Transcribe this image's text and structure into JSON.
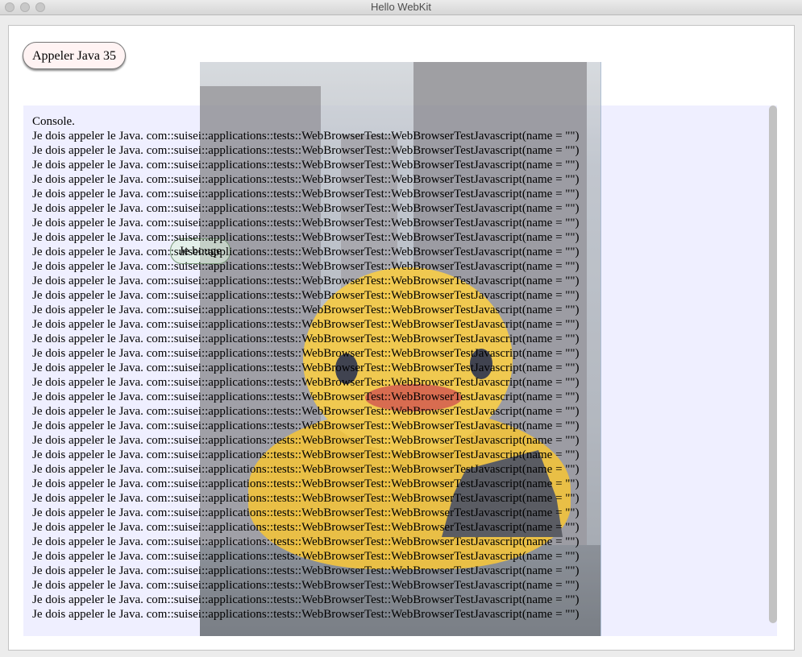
{
  "window": {
    "title": "Hello WebKit"
  },
  "buttons": {
    "call_java": "Appeler Java 35",
    "move": "Je bouge"
  },
  "console": {
    "header": "Console.",
    "line": "Je dois appeler le Java. com::suisei::applications::tests::WebBrowserTest::WebBrowserTestJavascript(name = \"\")",
    "line_count": 34
  }
}
